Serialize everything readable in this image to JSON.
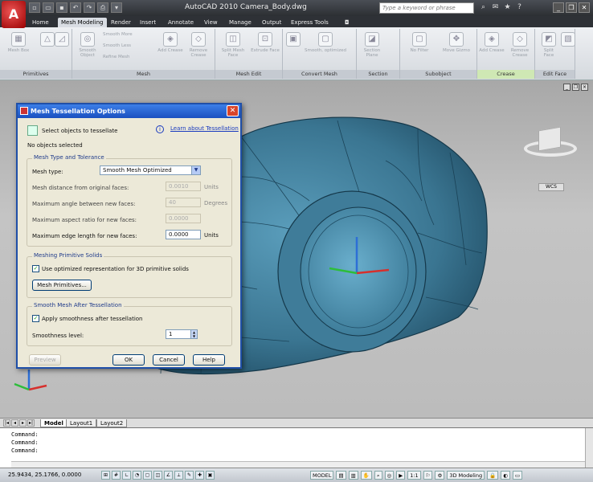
{
  "titlebar": {
    "app_logo": "A",
    "title": "AutoCAD 2010    Camera_Body.dwg",
    "search_placeholder": "Type a keyword or phrase",
    "qat_icons": [
      "new-icon",
      "open-icon",
      "save-icon",
      "undo-icon",
      "redo-icon",
      "plot-icon",
      "dropdown-icon"
    ]
  },
  "tabs": [
    "Home",
    "Mesh Modeling",
    "Render",
    "Insert",
    "Annotate",
    "View",
    "Manage",
    "Output",
    "Express Tools"
  ],
  "ribbon": {
    "panels": [
      {
        "title": "Primitives",
        "buttons": [
          "Mesh Box",
          "",
          ""
        ]
      },
      {
        "title": "Mesh",
        "buttons": [
          "Smooth Object",
          "Smooth More",
          "Smooth Less",
          "Refine Mesh",
          "Add Crease",
          "Remove Crease"
        ]
      },
      {
        "title": "Mesh Edit",
        "buttons": [
          "Split Mesh Face",
          "Extrude Face"
        ]
      },
      {
        "title": "Convert Mesh",
        "buttons": [
          "Smooth, optimized"
        ]
      },
      {
        "title": "Section",
        "buttons": [
          "Section Plane"
        ]
      },
      {
        "title": "Subobject",
        "buttons": [
          "No Filter",
          "Move Gizmo"
        ]
      },
      {
        "title": "Crease",
        "buttons": [
          "Add Crease",
          "Remove Crease"
        ]
      },
      {
        "title": "Edit Face",
        "buttons": [
          "Split Face"
        ]
      }
    ]
  },
  "viewport": {
    "wcs_label": "WCS"
  },
  "dialog": {
    "title": "Mesh Tessellation Options",
    "select_label": "Select objects to tessellate",
    "learn_link": "Learn about Tessellation",
    "no_objects": "No objects selected",
    "mesh_type_group": "Mesh Type and Tolerance",
    "mesh_type_label": "Mesh type:",
    "mesh_type_value": "Smooth Mesh Optimized",
    "distance_label": "Mesh distance from original faces:",
    "distance_value": "0.0010",
    "distance_unit": "Units",
    "angle_label": "Maximum angle between new faces:",
    "angle_value": "40",
    "angle_unit": "Degrees",
    "aspect_label": "Maximum aspect ratio for new faces:",
    "aspect_value": "0.0000",
    "edge_label": "Maximum edge length for new faces:",
    "edge_value": "0.0000",
    "edge_unit": "Units",
    "primitive_group": "Meshing Primitive Solids",
    "primitive_check_label": "Use optimized representation for 3D primitive solids",
    "mesh_primitives_btn": "Mesh Primitives...",
    "smooth_group": "Smooth Mesh After Tessellation",
    "smooth_check_label": "Apply smoothness after tessellation",
    "smoothness_label": "Smoothness level:",
    "smoothness_value": "1",
    "preview_btn": "Preview",
    "ok_btn": "OK",
    "cancel_btn": "Cancel",
    "help_btn": "Help"
  },
  "model_tabs": [
    "Model",
    "Layout1",
    "Layout2"
  ],
  "command": {
    "lines": [
      "Command:",
      "Command:",
      "Command:"
    ]
  },
  "status": {
    "coords": "25.9434, 25.1766, 0.0000",
    "model": "MODEL",
    "scale": "1:1",
    "workspace": "3D Modeling"
  },
  "colors": {
    "title_bg": "#2c2f33",
    "dialog_title": "#1a50c0",
    "mesh_fill": "#3f7c99",
    "viewport_bg": "#bcbcbc"
  }
}
